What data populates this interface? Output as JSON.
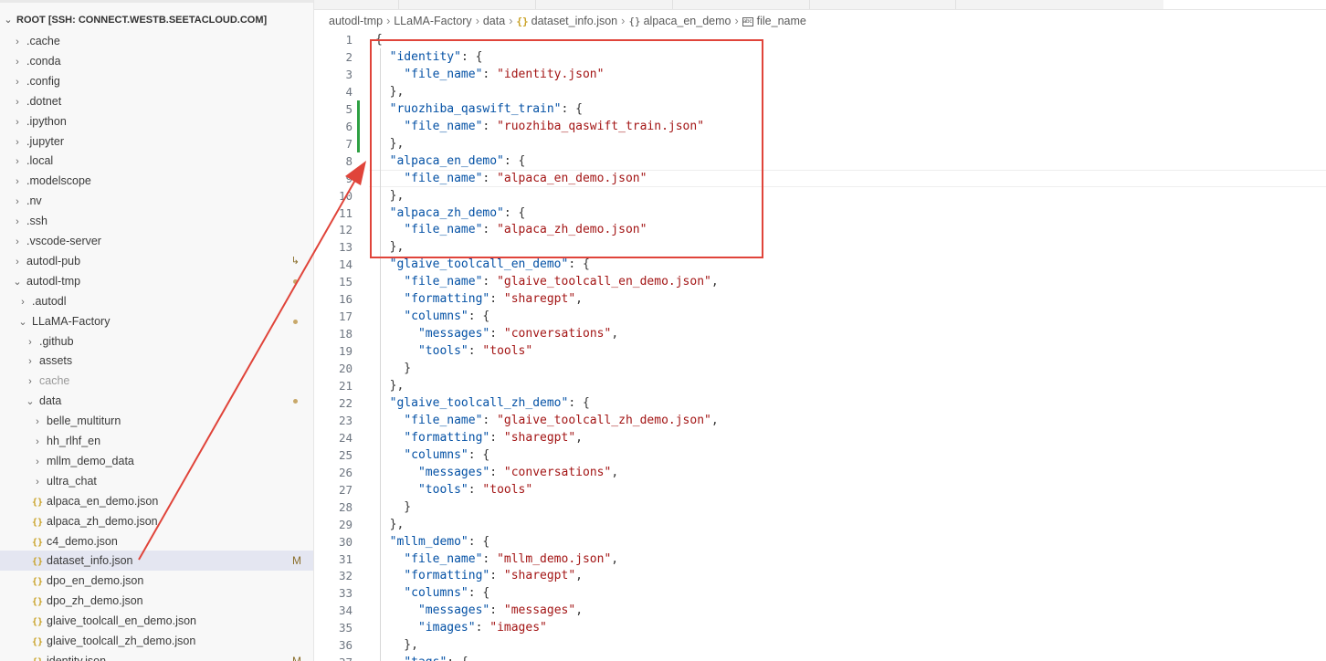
{
  "explorer": {
    "root_label": "ROOT [SSH: CONNECT.WESTB.SEETACLOUD.COM]",
    "items": [
      {
        "label": ".cache",
        "kind": "folder",
        "open": false,
        "depth": 0
      },
      {
        "label": ".conda",
        "kind": "folder",
        "open": false,
        "depth": 0
      },
      {
        "label": ".config",
        "kind": "folder",
        "open": false,
        "depth": 0
      },
      {
        "label": ".dotnet",
        "kind": "folder",
        "open": false,
        "depth": 0
      },
      {
        "label": ".ipython",
        "kind": "folder",
        "open": false,
        "depth": 0
      },
      {
        "label": ".jupyter",
        "kind": "folder",
        "open": false,
        "depth": 0
      },
      {
        "label": ".local",
        "kind": "folder",
        "open": false,
        "depth": 0
      },
      {
        "label": ".modelscope",
        "kind": "folder",
        "open": false,
        "depth": 0
      },
      {
        "label": ".nv",
        "kind": "folder",
        "open": false,
        "depth": 0
      },
      {
        "label": ".ssh",
        "kind": "folder",
        "open": false,
        "depth": 0
      },
      {
        "label": ".vscode-server",
        "kind": "folder",
        "open": false,
        "depth": 0
      },
      {
        "label": "autodl-pub",
        "kind": "folder",
        "open": false,
        "depth": 0,
        "icon": "symlink-icon"
      },
      {
        "label": "autodl-tmp",
        "kind": "folder",
        "open": true,
        "depth": 0,
        "decoration": "dot"
      },
      {
        "label": ".autodl",
        "kind": "folder",
        "open": false,
        "depth": 1
      },
      {
        "label": "LLaMA-Factory",
        "kind": "folder",
        "open": true,
        "depth": 1,
        "decoration": "dot",
        "modified": true
      },
      {
        "label": ".github",
        "kind": "folder",
        "open": false,
        "depth": 2
      },
      {
        "label": "assets",
        "kind": "folder",
        "open": false,
        "depth": 2
      },
      {
        "label": "cache",
        "kind": "folder",
        "open": false,
        "depth": 2,
        "dim": true
      },
      {
        "label": "data",
        "kind": "folder",
        "open": true,
        "depth": 2,
        "decoration": "dot",
        "modified": true
      },
      {
        "label": "belle_multiturn",
        "kind": "folder",
        "open": false,
        "depth": 3
      },
      {
        "label": "hh_rlhf_en",
        "kind": "folder",
        "open": false,
        "depth": 3
      },
      {
        "label": "mllm_demo_data",
        "kind": "folder",
        "open": false,
        "depth": 3
      },
      {
        "label": "ultra_chat",
        "kind": "folder",
        "open": false,
        "depth": 3
      },
      {
        "label": "alpaca_en_demo.json",
        "kind": "json",
        "depth": 3
      },
      {
        "label": "alpaca_zh_demo.json",
        "kind": "json",
        "depth": 3
      },
      {
        "label": "c4_demo.json",
        "kind": "json",
        "depth": 3
      },
      {
        "label": "dataset_info.json",
        "kind": "json",
        "depth": 3,
        "selected": true,
        "badge": "M"
      },
      {
        "label": "dpo_en_demo.json",
        "kind": "json",
        "depth": 3
      },
      {
        "label": "dpo_zh_demo.json",
        "kind": "json",
        "depth": 3
      },
      {
        "label": "glaive_toolcall_en_demo.json",
        "kind": "json",
        "depth": 3
      },
      {
        "label": "glaive_toolcall_zh_demo.json",
        "kind": "json",
        "depth": 3
      },
      {
        "label": "identity.json",
        "kind": "json",
        "depth": 3,
        "badge": "M"
      }
    ]
  },
  "breadcrumb": {
    "parts": [
      "autodl-tmp",
      "LLaMA-Factory",
      "data",
      "dataset_info.json",
      "alpaca_en_demo",
      "file_name"
    ]
  },
  "editor": {
    "lines": [
      {
        "n": "1",
        "text": "{"
      },
      {
        "n": "2",
        "text": "  \"identity\": {"
      },
      {
        "n": "3",
        "text": "    \"file_name\": \"identity.json\""
      },
      {
        "n": "4",
        "text": "  },"
      },
      {
        "n": "5",
        "text": "  \"ruozhiba_qaswift_train\": {"
      },
      {
        "n": "6",
        "text": "    \"file_name\": \"ruozhiba_qaswift_train.json\""
      },
      {
        "n": "7",
        "text": "  },"
      },
      {
        "n": "8",
        "text": "  \"alpaca_en_demo\": {"
      },
      {
        "n": "9",
        "text": "    \"file_name\": \"alpaca_en_demo.json\""
      },
      {
        "n": "10",
        "text": "  },"
      },
      {
        "n": "11",
        "text": "  \"alpaca_zh_demo\": {"
      },
      {
        "n": "12",
        "text": "    \"file_name\": \"alpaca_zh_demo.json\""
      },
      {
        "n": "13",
        "text": "  },"
      },
      {
        "n": "14",
        "text": "  \"glaive_toolcall_en_demo\": {"
      },
      {
        "n": "15",
        "text": "    \"file_name\": \"glaive_toolcall_en_demo.json\","
      },
      {
        "n": "16",
        "text": "    \"formatting\": \"sharegpt\","
      },
      {
        "n": "17",
        "text": "    \"columns\": {"
      },
      {
        "n": "18",
        "text": "      \"messages\": \"conversations\","
      },
      {
        "n": "19",
        "text": "      \"tools\": \"tools\""
      },
      {
        "n": "20",
        "text": "    }"
      },
      {
        "n": "21",
        "text": "  },"
      },
      {
        "n": "22",
        "text": "  \"glaive_toolcall_zh_demo\": {"
      },
      {
        "n": "23",
        "text": "    \"file_name\": \"glaive_toolcall_zh_demo.json\","
      },
      {
        "n": "24",
        "text": "    \"formatting\": \"sharegpt\","
      },
      {
        "n": "25",
        "text": "    \"columns\": {"
      },
      {
        "n": "26",
        "text": "      \"messages\": \"conversations\","
      },
      {
        "n": "27",
        "text": "      \"tools\": \"tools\""
      },
      {
        "n": "28",
        "text": "    }"
      },
      {
        "n": "29",
        "text": "  },"
      },
      {
        "n": "30",
        "text": "  \"mllm_demo\": {"
      },
      {
        "n": "31",
        "text": "    \"file_name\": \"mllm_demo.json\","
      },
      {
        "n": "32",
        "text": "    \"formatting\": \"sharegpt\","
      },
      {
        "n": "33",
        "text": "    \"columns\": {"
      },
      {
        "n": "34",
        "text": "      \"messages\": \"messages\","
      },
      {
        "n": "35",
        "text": "      \"images\": \"images\""
      },
      {
        "n": "36",
        "text": "    },"
      },
      {
        "n": "37",
        "text": "    \"tags\": {"
      }
    ],
    "current_line": "9",
    "git_modified_lines": [
      "5",
      "6",
      "7"
    ]
  },
  "colors": {
    "annotation": "#e0443a",
    "json_key": "#0451a5",
    "json_string": "#a31515",
    "git_added": "#2ea043",
    "selection_bg": "#e4e6f1"
  },
  "icons": {
    "chevron_right": "chevron-right-icon",
    "chevron_down": "chevron-down-icon",
    "json_file": "json-file-icon",
    "symbol": "symbol-field-icon"
  }
}
